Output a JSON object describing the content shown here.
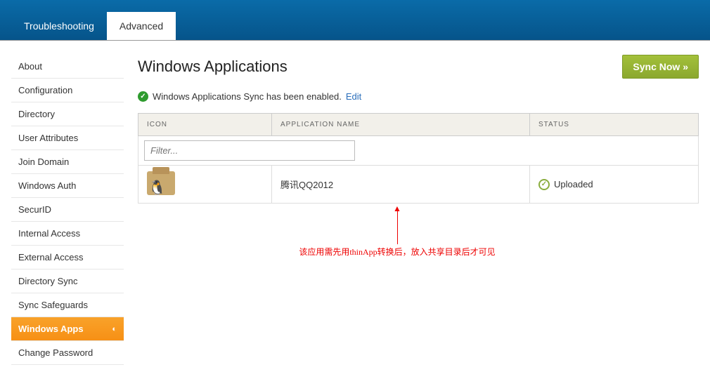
{
  "topbar": {
    "tabs": [
      {
        "label": "Troubleshooting",
        "active": false
      },
      {
        "label": "Advanced",
        "active": true
      }
    ]
  },
  "sidebar": {
    "items": [
      {
        "label": "About"
      },
      {
        "label": "Configuration"
      },
      {
        "label": "Directory"
      },
      {
        "label": "User Attributes"
      },
      {
        "label": "Join Domain"
      },
      {
        "label": "Windows Auth"
      },
      {
        "label": "SecurID"
      },
      {
        "label": "Internal Access"
      },
      {
        "label": "External Access"
      },
      {
        "label": "Directory Sync"
      },
      {
        "label": "Sync Safeguards"
      },
      {
        "label": "Windows Apps",
        "active": true
      },
      {
        "label": "Change Password"
      }
    ]
  },
  "page": {
    "title": "Windows Applications",
    "sync_button": "Sync Now »",
    "status_text": "Windows Applications Sync has been enabled.",
    "edit_link": "Edit"
  },
  "table": {
    "headers": {
      "icon": "ICON",
      "name": "APPLICATION NAME",
      "status": "STATUS"
    },
    "filter_placeholder": "Filter...",
    "rows": [
      {
        "name": "腾讯QQ2012",
        "status": "Uploaded"
      }
    ]
  },
  "annotation": {
    "text": "该应用需先用thinApp转换后，放入共享目录后才可见"
  }
}
